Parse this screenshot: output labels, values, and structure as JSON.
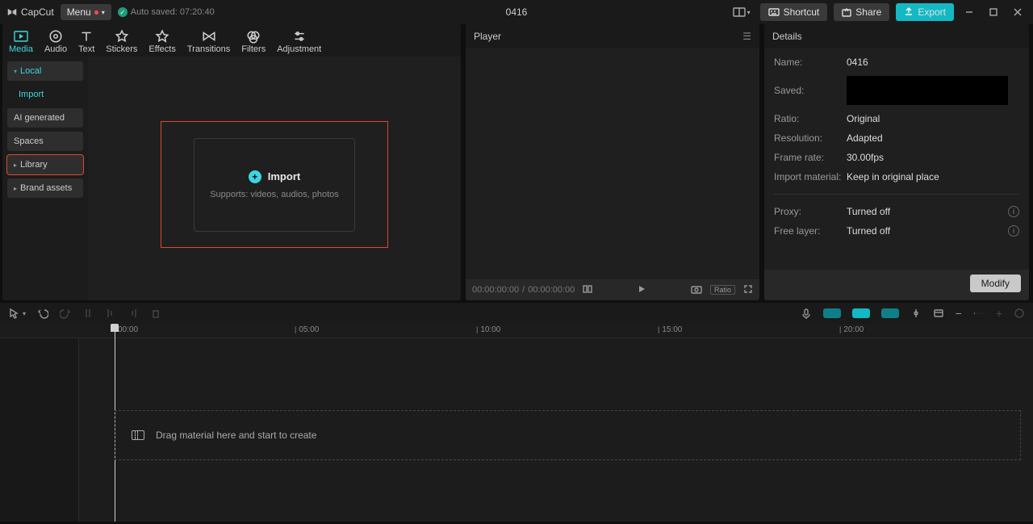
{
  "topbar": {
    "brand": "CapCut",
    "menu_label": "Menu",
    "autosaved_label": "Auto saved: 07:20:40",
    "project_title": "0416",
    "shortcut_label": "Shortcut",
    "share_label": "Share",
    "export_label": "Export"
  },
  "asset_tabs": [
    "Media",
    "Audio",
    "Text",
    "Stickers",
    "Effects",
    "Transitions",
    "Filters",
    "Adjustment"
  ],
  "asset_sidebar": {
    "local": "Local",
    "import": "Import",
    "ai": "AI generated",
    "spaces": "Spaces",
    "library": "Library",
    "brand": "Brand assets"
  },
  "import_box": {
    "title": "Import",
    "subtitle": "Supports: videos, audios, photos"
  },
  "player": {
    "header": "Player",
    "time_current": "00:00:00:00",
    "time_sep": " / ",
    "time_total": "00:00:00:00"
  },
  "details": {
    "header": "Details",
    "name_label": "Name:",
    "name_value": "0416",
    "saved_label": "Saved:",
    "ratio_label": "Ratio:",
    "ratio_value": "Original",
    "resolution_label": "Resolution:",
    "resolution_value": "Adapted",
    "framerate_label": "Frame rate:",
    "framerate_value": "30.00fps",
    "import_material_label": "Import material:",
    "import_material_value": "Keep in original place",
    "proxy_label": "Proxy:",
    "proxy_value": "Turned off",
    "freelayer_label": "Free layer:",
    "freelayer_value": "Turned off",
    "modify_label": "Modify"
  },
  "timeline": {
    "ticks": [
      "00:00",
      "05:00",
      "10:00",
      "15:00",
      "20:00"
    ],
    "drop_hint": "Drag material here and start to create"
  }
}
